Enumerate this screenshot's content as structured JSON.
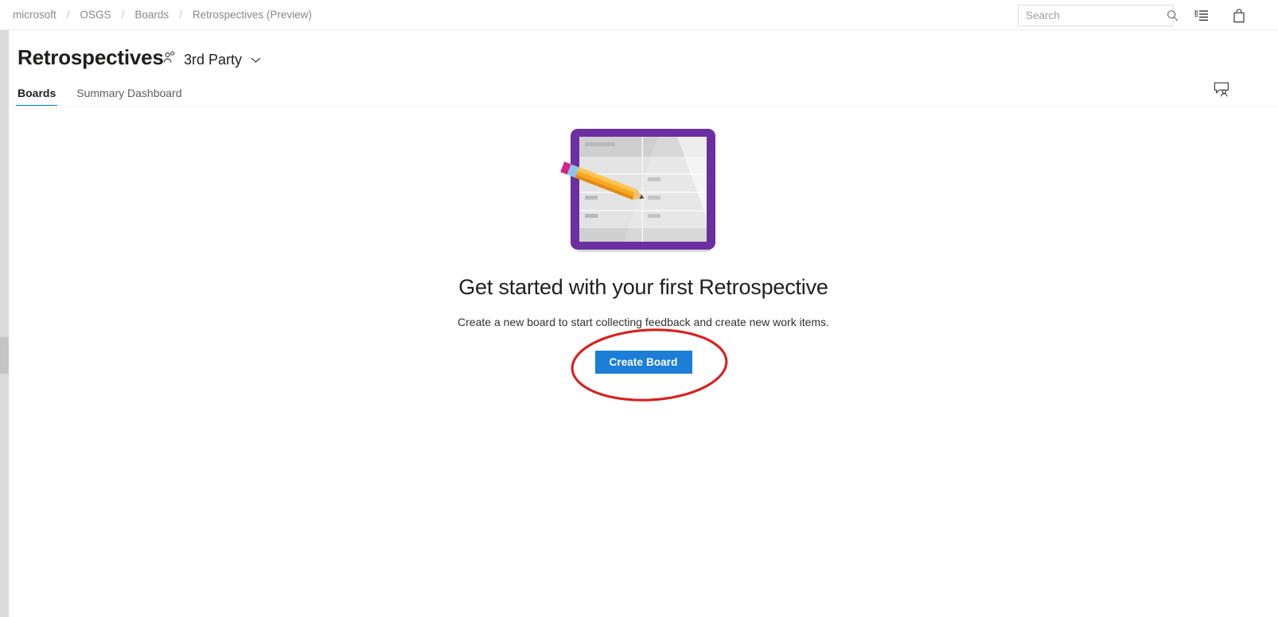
{
  "header": {
    "breadcrumb": [
      {
        "label": "microsoft"
      },
      {
        "label": "OSGS"
      },
      {
        "label": "Boards"
      },
      {
        "label": "Retrospectives (Preview)"
      }
    ],
    "separator": "/",
    "search": {
      "placeholder": "Search",
      "value": "",
      "icon": "search-icon"
    },
    "icons": [
      {
        "name": "backlog-list-icon"
      },
      {
        "name": "marketplace-bag-icon"
      }
    ]
  },
  "page": {
    "title": "Retrospectives",
    "team": {
      "name": "3rd Party",
      "icon": "team-people-icon",
      "chevron": "chevron-down-icon"
    },
    "tabs": [
      {
        "label": "Boards",
        "active": true
      },
      {
        "label": "Summary Dashboard",
        "active": false
      }
    ],
    "feedback_icon": "feedback-person-icon"
  },
  "empty_state": {
    "illustration": "retrospective-board-pencil-illustration",
    "title": "Get started with your first Retrospective",
    "subtitle": "Create a new board to start collecting feedback and create new work items.",
    "primary_button": "Create Board"
  },
  "annotation": {
    "shape": "red-ellipse-highlight",
    "color": "#d91e1e",
    "targets": "Create Board"
  },
  "colors": {
    "accent_blue": "#0078d4",
    "button_blue": "#1c7ed6",
    "illustration_purple": "#6b2fa0",
    "illustration_orange": "#f5a623",
    "annotation_red": "#d91e1e",
    "text_primary": "#201f1e",
    "text_secondary": "#605e5c",
    "breadcrumb_gray": "#8a8886"
  },
  "scrollbar": {
    "name": "left-vertical-scrollbar",
    "thumb": "scrollbar-thumb"
  }
}
